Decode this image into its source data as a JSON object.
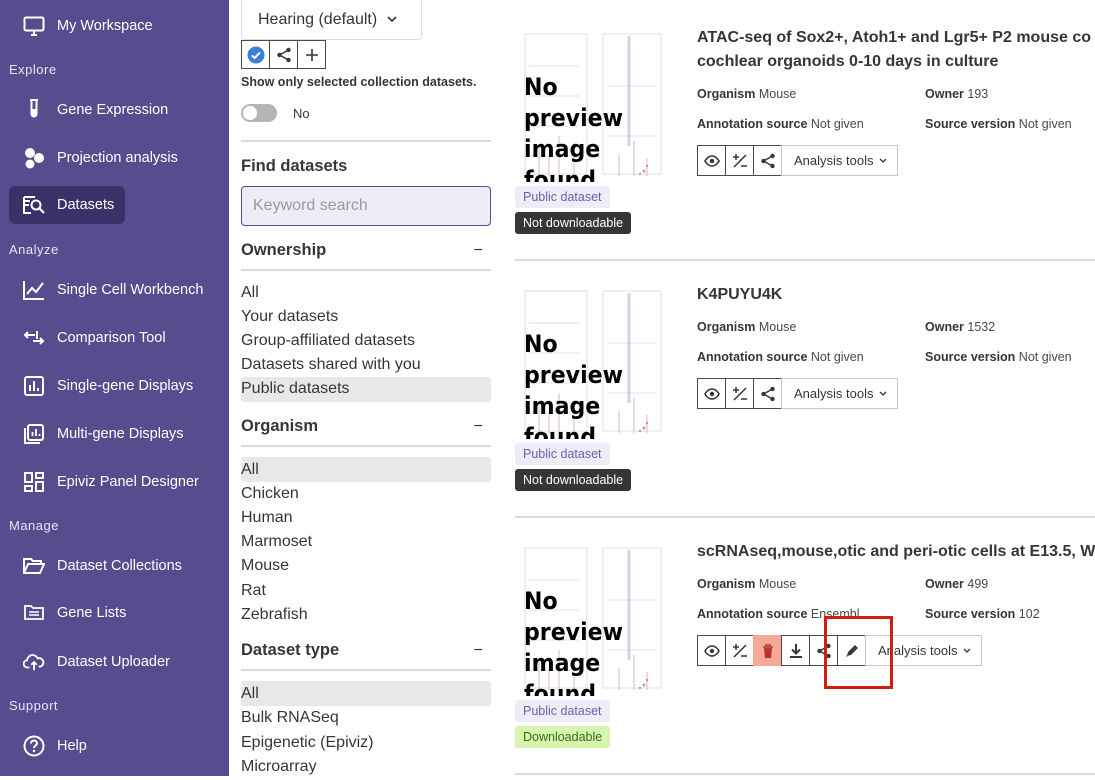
{
  "sidebar": {
    "workspace": "My Workspace",
    "sections": {
      "explore": "Explore",
      "analyze": "Analyze",
      "manage": "Manage",
      "support": "Support"
    },
    "items": {
      "gene_expression": "Gene Expression",
      "projection": "Projection analysis",
      "datasets": "Datasets",
      "sc_workbench": "Single Cell Workbench",
      "comparison": "Comparison Tool",
      "single_gene": "Single-gene Displays",
      "multi_gene": "Multi-gene Displays",
      "epiviz": "Epiviz Panel Designer",
      "collections": "Dataset Collections",
      "gene_lists": "Gene Lists",
      "uploader": "Dataset Uploader",
      "help": "Help"
    }
  },
  "filters": {
    "collection_selected": "Hearing (default)",
    "show_only_label": "Show only selected collection datasets.",
    "toggle_label": "No",
    "find_heading": "Find datasets",
    "search_placeholder": "Keyword search",
    "ownership": {
      "heading": "Ownership",
      "collapse": "−",
      "options": [
        "All",
        "Your datasets",
        "Group-affiliated datasets",
        "Datasets shared with you",
        "Public datasets"
      ],
      "selected": "Public datasets"
    },
    "organism": {
      "heading": "Organism",
      "collapse": "−",
      "options": [
        "All",
        "Chicken",
        "Human",
        "Marmoset",
        "Mouse",
        "Rat",
        "Zebrafish"
      ],
      "selected": "All"
    },
    "dataset_type": {
      "heading": "Dataset type",
      "collapse": "−",
      "options": [
        "All",
        "Bulk RNASeq",
        "Epigenetic (Epiviz)",
        "Microarray"
      ],
      "selected": "All"
    }
  },
  "results": {
    "no_preview": [
      "No preview",
      "image found"
    ],
    "labels": {
      "organism": "Organism",
      "owner": "Owner",
      "annotation_source": "Annotation source",
      "source_version": "Source version",
      "analysis_tools": "Analysis tools"
    },
    "cards": [
      {
        "title_line1": "ATAC-seq of Sox2+, Atoh1+ and Lgr5+ P2 mouse co",
        "title_line2": "cochlear organoids 0-10 days in culture",
        "organism": "Mouse",
        "owner": "193",
        "annotation_source": "Not given",
        "source_version": "Not given",
        "visibility": "Public dataset",
        "download": "Not downloadable"
      },
      {
        "title_line1": "K4PUYU4K",
        "organism": "Mouse",
        "owner": "1532",
        "annotation_source": "Not given",
        "source_version": "Not given",
        "visibility": "Public dataset",
        "download": "Not downloadable"
      },
      {
        "title_line1": "scRNAseq,mouse,otic and peri-otic cells at E13.5, W",
        "organism": "Mouse",
        "owner": "499",
        "annotation_source": "Ensembl",
        "source_version": "102",
        "visibility": "Public dataset",
        "download": "Downloadable"
      }
    ]
  },
  "colors": {
    "sidebar": "#564c8e",
    "sidebar_active": "#3a3168",
    "highlight": "#d21d0f",
    "danger": "#f7a896"
  }
}
